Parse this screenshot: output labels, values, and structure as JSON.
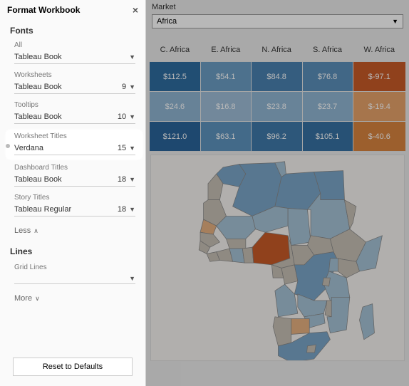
{
  "panel": {
    "title": "Format Workbook",
    "fonts_section": "Fonts",
    "lines_section": "Lines",
    "groups": {
      "all": {
        "label": "All",
        "font": "Tableau Book",
        "size": ""
      },
      "worksheets": {
        "label": "Worksheets",
        "font": "Tableau Book",
        "size": "9"
      },
      "tooltips": {
        "label": "Tooltips",
        "font": "Tableau Book",
        "size": "10"
      },
      "worksheet_titles": {
        "label": "Worksheet Titles",
        "font": "Verdana",
        "size": "15"
      },
      "dashboard_titles": {
        "label": "Dashboard Titles",
        "font": "Tableau Book",
        "size": "18"
      },
      "story_titles": {
        "label": "Story Titles",
        "font": "Tableau Regular",
        "size": "18"
      }
    },
    "less": "Less",
    "more": "More",
    "grid_lines": "Grid Lines",
    "reset": "Reset to Defaults"
  },
  "viz": {
    "market_label": "Market",
    "market_value": "Africa",
    "headers": [
      "C. Africa",
      "E. Africa",
      "N. Africa",
      "S. Africa",
      "W. Africa"
    ],
    "rows": [
      {
        "cells": [
          {
            "v": "$112.5",
            "c": "#2e6ca0"
          },
          {
            "v": "$54.1",
            "c": "#6b9dc4"
          },
          {
            "v": "$84.8",
            "c": "#4a82b0"
          },
          {
            "v": "$76.8",
            "c": "#5a8fba"
          },
          {
            "v": "$-97.1",
            "c": "#c85a28"
          }
        ]
      },
      {
        "cells": [
          {
            "v": "$24.6",
            "c": "#8fb4d2"
          },
          {
            "v": "$16.8",
            "c": "#9ebdd7"
          },
          {
            "v": "$23.8",
            "c": "#91b6d3"
          },
          {
            "v": "$23.7",
            "c": "#91b6d3"
          },
          {
            "v": "$-19.4",
            "c": "#e6a36a"
          }
        ]
      },
      {
        "cells": [
          {
            "v": "$121.0",
            "c": "#2a649a"
          },
          {
            "v": "$63.1",
            "c": "#5e94be"
          },
          {
            "v": "$96.2",
            "c": "#3f79aa"
          },
          {
            "v": "$105.1",
            "c": "#3671a3"
          },
          {
            "v": "$-40.6",
            "c": "#d9843f"
          }
        ]
      }
    ]
  },
  "map": {
    "colors": {
      "default": "#c7c0b5",
      "blue_light": "#a6c2d6",
      "blue_med": "#7ba5c8",
      "blue_dark": "#5a8cb8",
      "orange_light": "#e6b080",
      "orange_dark": "#c85a28",
      "border": "#888"
    }
  }
}
